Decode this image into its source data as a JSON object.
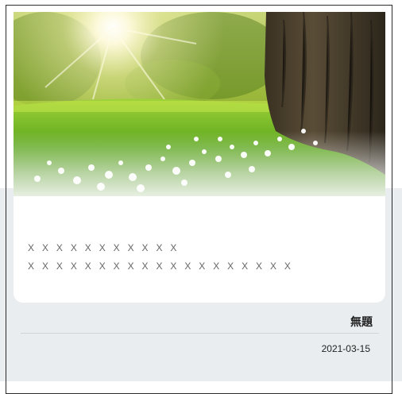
{
  "card": {
    "image": "meadow-sunlight-tree-photo",
    "excerpt_lines": [
      "X X X X X X X X X X X",
      "X X X X X X X X X X X X X X X X X X X"
    ],
    "title": "無題",
    "date": "2021-03-15"
  }
}
